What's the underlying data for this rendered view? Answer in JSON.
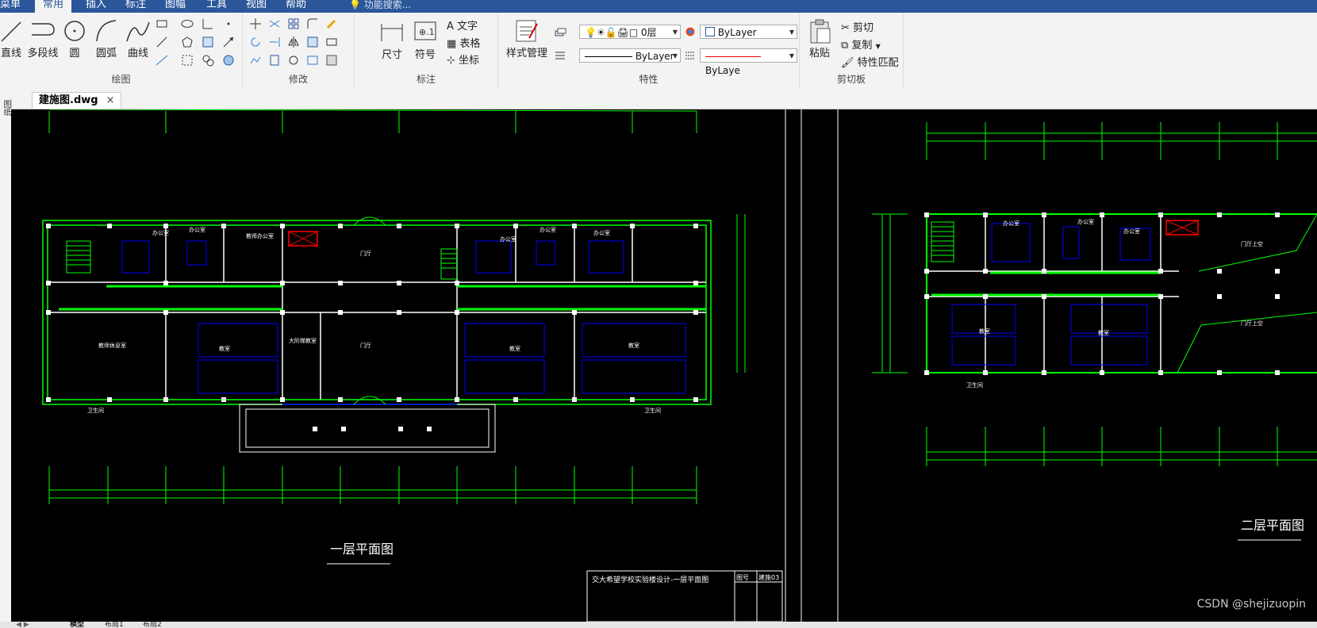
{
  "menubar": {
    "items": [
      "菜单",
      "常用",
      "插入",
      "标注",
      "图幅",
      "工具",
      "视图",
      "帮助"
    ],
    "active_index": 1,
    "search_placeholder": "功能搜索..."
  },
  "ribbon": {
    "draw": {
      "label": "绘图",
      "tools": [
        "直线",
        "多段线",
        "圆",
        "圆弧",
        "曲线"
      ]
    },
    "modify": {
      "label": "修改"
    },
    "dimension": {
      "label": "标注",
      "tools": [
        "尺寸",
        "符号"
      ],
      "text": "文字",
      "table": "表格",
      "coord": "坐标"
    },
    "properties": {
      "label": "特性",
      "style_manager": "样式管理",
      "layer_value": "0层",
      "color_value": "ByLayer",
      "linetype_value": "ByLayer",
      "lineweight_value": "ByLaye"
    },
    "clipboard": {
      "label": "剪切板",
      "paste": "粘贴",
      "cut": "剪切",
      "copy": "复制",
      "match": "特性匹配"
    }
  },
  "document_tab": {
    "label": "建施图.dwg"
  },
  "sidebar": {
    "label": "图纸"
  },
  "drawing": {
    "left": {
      "title": "一层平面图",
      "rooms": [
        "办公室",
        "办公室",
        "教师办公室",
        "门厅",
        "办公室",
        "办公室",
        "办公室",
        "教师休息室",
        "大阶梯教室",
        "门厅",
        "教室",
        "教室",
        "教室",
        "卫生间",
        "卫生间"
      ],
      "title_block": {
        "project": "交大希望学校实验楼设计-一层平面图",
        "sheet_label": "图号",
        "sheet_no": "建施03"
      }
    },
    "right": {
      "title": "二层平面图",
      "rooms": [
        "办公室",
        "办公室",
        "办公室",
        "门厅上空",
        "门厅上空",
        "教室",
        "教室",
        "卫生间"
      ]
    }
  },
  "layout_tabs": [
    "模型",
    "布局1",
    "布局2"
  ],
  "watermark": "CSDN @shejizuopin",
  "colors": {
    "ribbon_blue": "#2b579a",
    "cad_green": "#00ff00",
    "cad_blue": "#0000ff",
    "cad_red": "#ff0000",
    "canvas_bg": "#000000"
  }
}
